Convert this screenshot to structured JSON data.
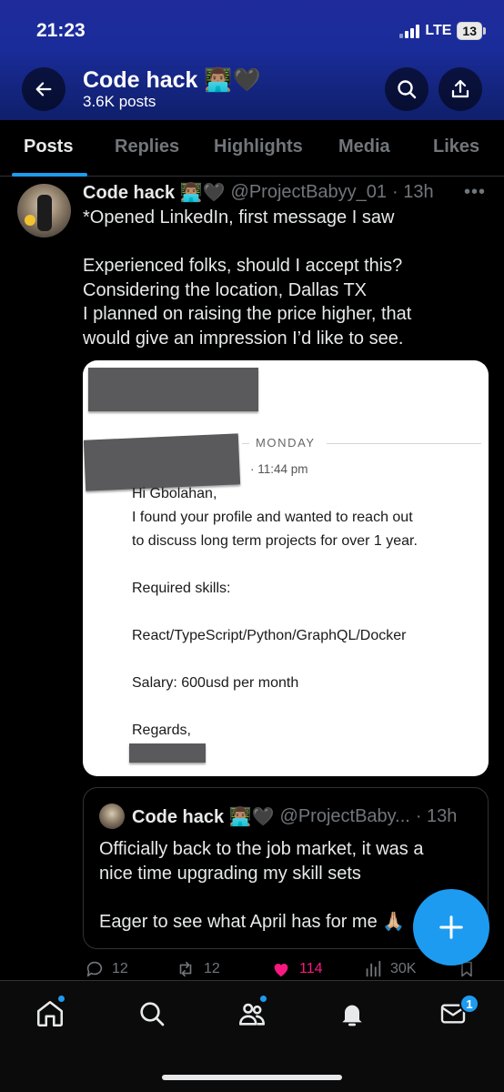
{
  "status_bar": {
    "time": "21:23",
    "network": "LTE",
    "battery": "13"
  },
  "header": {
    "name": "Code hack 👨🏽‍💻🖤",
    "post_count": "3.6K posts"
  },
  "tabs": [
    {
      "label": "Posts",
      "active": true
    },
    {
      "label": "Replies"
    },
    {
      "label": "Highlights"
    },
    {
      "label": "Media"
    },
    {
      "label": "Likes"
    }
  ],
  "tweet": {
    "name": "Code hack 👨🏽‍💻🖤",
    "handle": "@ProjectBabyy_01",
    "time": "· 13h",
    "text_lines": [
      "*Opened LinkedIn, first message I saw",
      "",
      "Experienced folks, should I accept this?",
      "Considering the location, Dallas TX",
      "I planned on raising the price higher, that",
      "would give an impression I’d like to see."
    ],
    "media": {
      "day_label": "MONDAY",
      "message_time": "· 11:44 pm",
      "message_lines": [
        "Hi Gbolahan,",
        "I found your profile and wanted to reach out",
        "to discuss long term projects for over 1 year.",
        "",
        "Required skills:",
        "",
        "React/TypeScript/Python/GraphQL/Docker",
        "",
        "Salary: 600usd per month",
        "",
        "Regards,"
      ]
    },
    "quote": {
      "name": "Code hack 👨🏽‍💻🖤",
      "handle": "@ProjectBaby...",
      "time": "· 13h",
      "text_lines": [
        "Officially back to the job market, it was a",
        "nice time upgrading my skill sets",
        "",
        "Eager to see what April has for me 🙏🏼"
      ]
    },
    "actions": {
      "replies": "12",
      "reposts": "12",
      "likes": "114",
      "views": "30K"
    }
  },
  "bottom_nav": {
    "items": [
      "home-icon",
      "search-icon",
      "communities-icon",
      "notifications-icon",
      "messages-icon"
    ],
    "messages_badge": "1"
  },
  "colors": {
    "accent": "#1d9bf0",
    "like": "#f91880",
    "muted": "#71767b",
    "header_bg": "#1a2c9a"
  }
}
